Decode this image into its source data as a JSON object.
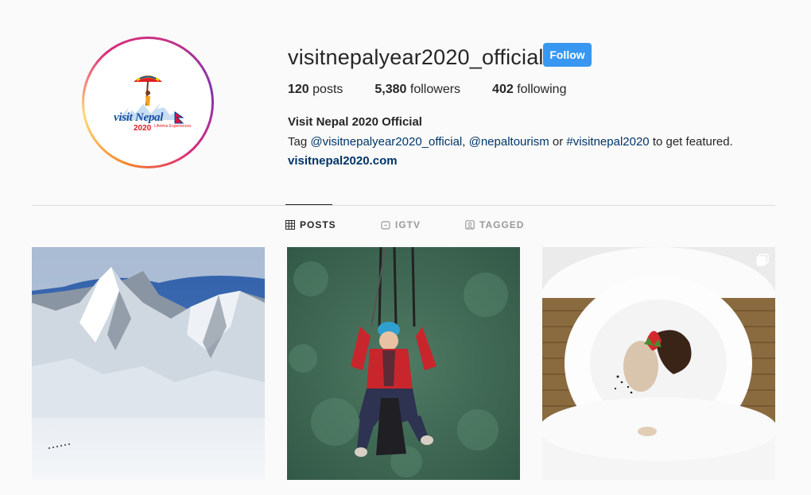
{
  "profile": {
    "username": "visitnepalyear2020_official",
    "follow_label": "Follow",
    "posts_count": "120",
    "posts_label": "posts",
    "followers_count": "5,380",
    "followers_label": "followers",
    "following_count": "402",
    "following_label": "following",
    "full_name": "Visit Nepal 2020 Official",
    "bio": {
      "prefix": "Tag ",
      "mention1": "@visitnepalyear2020_official",
      "sep1": ", ",
      "mention2": "@nepaltourism",
      "sep2": " or ",
      "hashtag": "#visitnepal2020",
      "suffix": " to get featured."
    },
    "website": "visitnepal2020.com"
  },
  "avatar": {
    "logo_text": "visit Nepal",
    "logo_year": "2020",
    "logo_tagline": "Lifetime Experiences"
  },
  "tabs": [
    {
      "label": "POSTS",
      "icon": "grid-icon",
      "active": true
    },
    {
      "label": "IGTV",
      "icon": "igtv-icon",
      "active": false
    },
    {
      "label": "TAGGED",
      "icon": "tagged-icon",
      "active": false
    }
  ],
  "posts": [
    {
      "subject": "snowy-mountain",
      "multi": false
    },
    {
      "subject": "zipline-rider",
      "multi": false
    },
    {
      "subject": "dessert-plate",
      "multi": true
    }
  ],
  "colors": {
    "follow_button": "#3897f0",
    "link": "#003569",
    "text": "#262626",
    "muted": "#999999",
    "background": "#fafafa"
  }
}
